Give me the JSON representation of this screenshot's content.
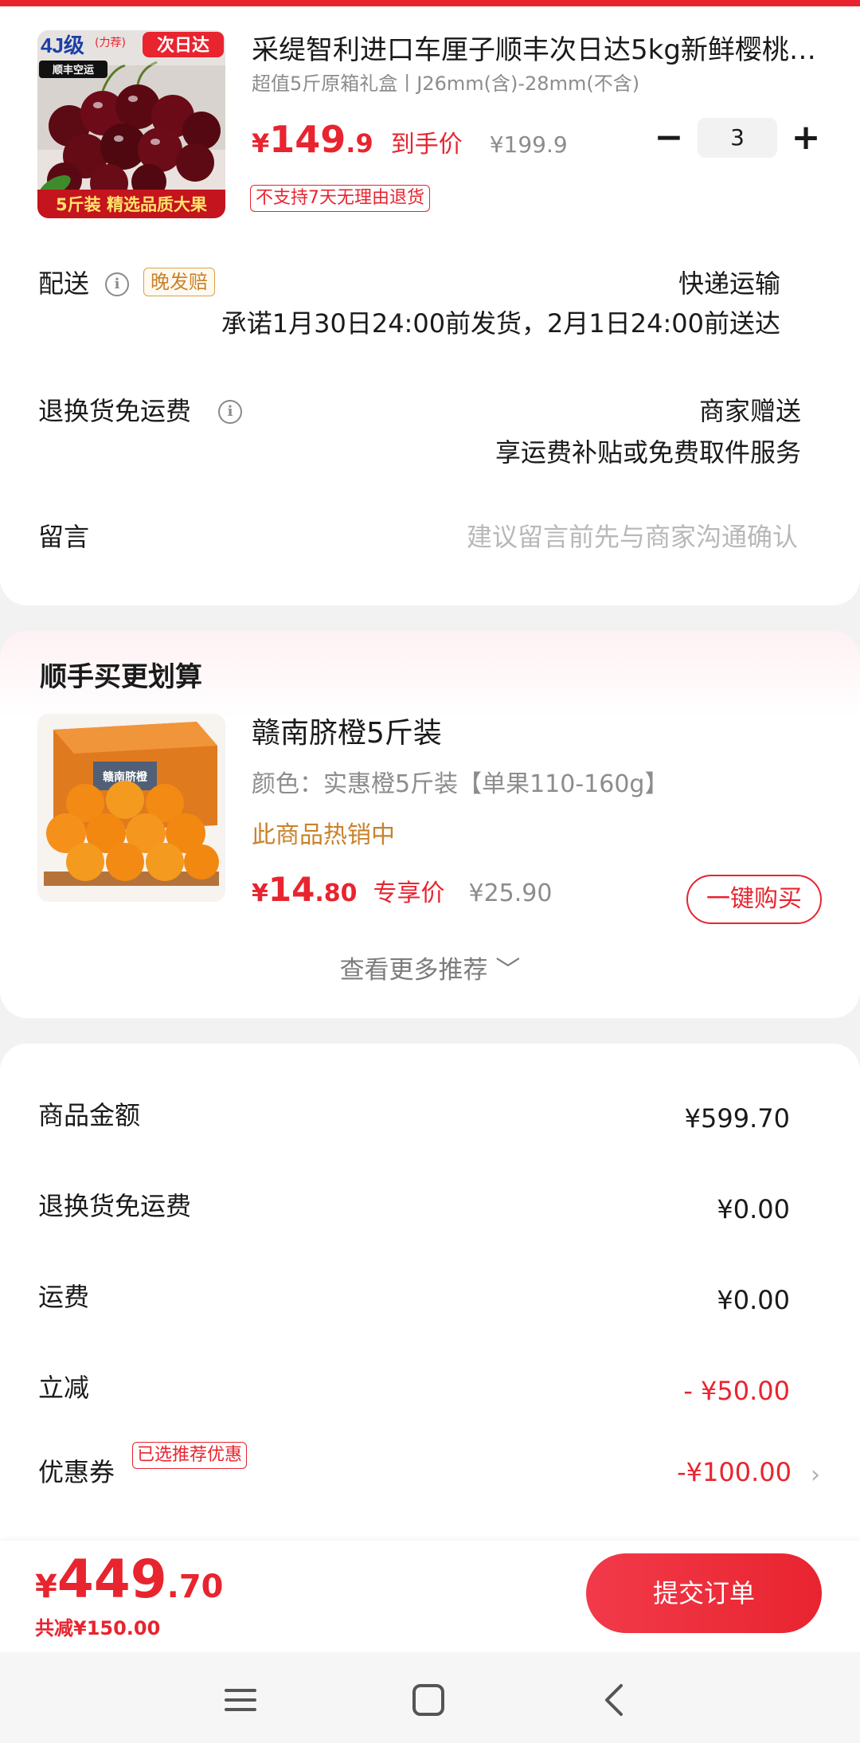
{
  "cart_item": {
    "title": "采缇智利进口车厘子顺丰次日达5kg新鲜樱桃…",
    "spec": "超值5斤原箱礼盒丨J26mm(含)-28mm(不含)",
    "price_currency": "¥",
    "price_integer": "149",
    "price_decimal": ".9",
    "price_tag": "到手价",
    "original_price": "¥199.9",
    "quantity": "3",
    "minus_label": "−",
    "plus_label": "+",
    "return_notice": "不支持7天无理由退货",
    "image_texts": {
      "grade": "4J级",
      "grade_sub": "(力荐)",
      "next_day": "次日达",
      "courier": "顺丰空运",
      "banner": "5斤装 精选品质大果"
    }
  },
  "delivery": {
    "label": "配送",
    "badge": "晚发赔",
    "method": "快递运输",
    "promise": "承诺1月30日24:00前发货，2月1日24:00前送达"
  },
  "return_shipping": {
    "label": "退换货免运费",
    "value": "商家赠送",
    "note": "享运费补贴或免费取件服务"
  },
  "message": {
    "label": "留言",
    "placeholder": "建议留言前先与商家沟通确认"
  },
  "recommend": {
    "section_title": "顺手买更划算",
    "product_name": "赣南脐橙5斤装",
    "color_label": "颜色：实惠橙5斤装【单果110-160g】",
    "hot_label": "此商品热销中",
    "price_currency": "¥",
    "price_integer": "14",
    "price_decimal": ".80",
    "price_tag": "专享价",
    "original_price": "¥25.90",
    "buy_button": "一键购买",
    "more_label": "查看更多推荐 ﹀",
    "box_text": "赣南脐橙"
  },
  "summary": {
    "items": [
      {
        "label": "商品金额",
        "value": "¥599.70"
      },
      {
        "label": "退换货免运费",
        "value": "¥0.00"
      },
      {
        "label": "运费",
        "value": "¥0.00"
      },
      {
        "label": "立减",
        "value": "- ¥50.00"
      },
      {
        "label": "优惠券",
        "value": "-¥100.00"
      }
    ],
    "coupon_badge": "已选推荐优惠",
    "chevron": "›"
  },
  "bottom": {
    "currency": "¥",
    "total_integer": "449",
    "total_decimal": ".70",
    "saved": "共减¥150.00",
    "submit_label": "提交订单"
  },
  "colors": {
    "accent": "#e8242f",
    "orange_text": "#c9822b",
    "muted": "#8c8c8c"
  }
}
